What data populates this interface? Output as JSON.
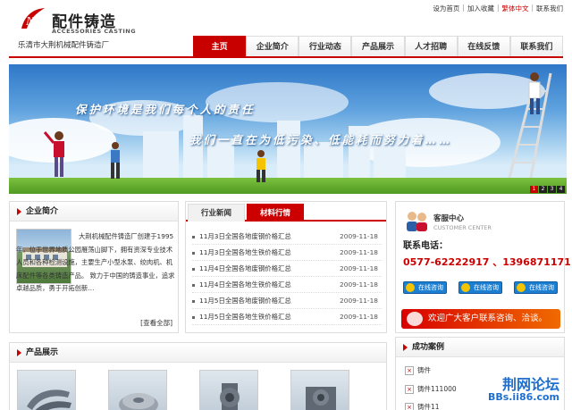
{
  "header": {
    "logo_text": "配件铸造",
    "logo_en": "ACCESSORIES CASTING",
    "company_name": "乐清市大荆机械配件铸造厂",
    "top_links": [
      "设为首页",
      "加入收藏",
      "繁体中文",
      "联系我们"
    ]
  },
  "nav": {
    "items": [
      {
        "label": "主页",
        "active": true
      },
      {
        "label": "企业简介"
      },
      {
        "label": "行业动态"
      },
      {
        "label": "产品展示"
      },
      {
        "label": "人才招聘"
      },
      {
        "label": "在线反馈"
      },
      {
        "label": "联系我们"
      }
    ]
  },
  "banner": {
    "slogan1": "保护环境是我们每个人的责任",
    "slogan2": "我们一直在为低污染、低能耗而努力着……",
    "pages": [
      "1",
      "2",
      "3",
      "4"
    ],
    "active_page": "1"
  },
  "intro": {
    "title": "企业简介",
    "text": "大荆机械配件铸造厂创建于1995年，位于世界地质公园雁荡山脚下，拥有资深专业技术人员和各种检测设施，主要生产小型水泵、绞肉机、机床配件等各类铸造产品。 致力于中国的铸造事业，追求卓越品质，勇于开拓创新…",
    "more": "[查看全部]"
  },
  "news": {
    "tabs": [
      {
        "label": "行业新闻",
        "active": false
      },
      {
        "label": "材料行情",
        "active": true
      }
    ],
    "items": [
      {
        "title": "11月3日全国各地废钢价格汇总",
        "date": "2009-11-18"
      },
      {
        "title": "11月3日全国各地生铁价格汇总",
        "date": "2009-11-18"
      },
      {
        "title": "11月4日全国各地废钢价格汇总",
        "date": "2009-11-18"
      },
      {
        "title": "11月4日全国各地生铁价格汇总",
        "date": "2009-11-18"
      },
      {
        "title": "11月5日全国各地废钢价格汇总",
        "date": "2009-11-18"
      },
      {
        "title": "11月5日全国各地生铁价格汇总",
        "date": "2009-11-18"
      }
    ]
  },
  "service": {
    "title": "客服中心",
    "title_en": "CUSTOMER CENTER",
    "tel_label": "联系电话：",
    "tel": "0577-62222917 、13968711711",
    "qq_buttons": [
      "在线咨询",
      "在线咨询",
      "在线咨询"
    ],
    "banner_text": "欢迎广大客户联系咨询、洽谈。"
  },
  "products": {
    "title": "产品展示"
  },
  "cases": {
    "title": "成功案例",
    "items": [
      "铸件",
      "铸件111000",
      "铸件11"
    ]
  },
  "watermark": {
    "cn": "荆网论坛",
    "url": "BBs.ii86.com"
  },
  "colors": {
    "brand_red": "#c80000",
    "sky_blue": "#5fa2de",
    "watermark_blue": "#1f6fd0"
  }
}
